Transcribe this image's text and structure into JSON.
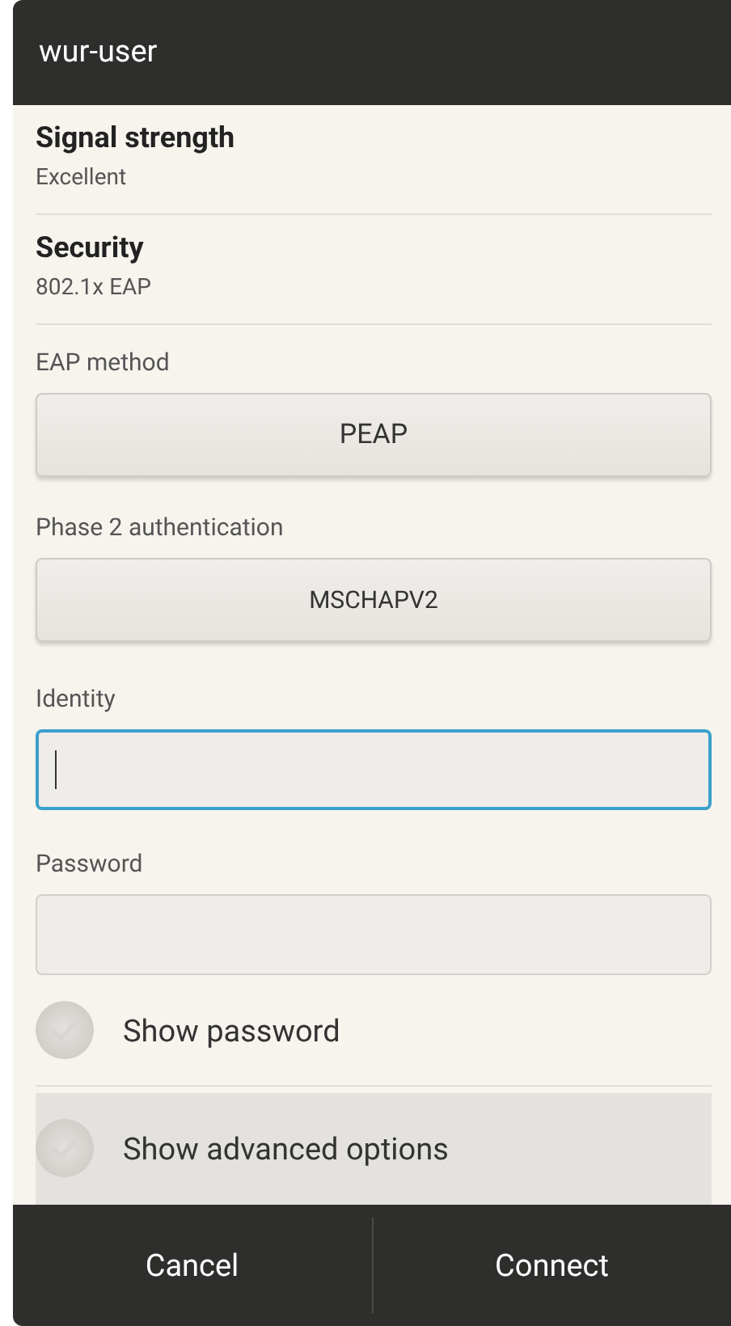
{
  "window": {
    "title": "wur-user"
  },
  "info": [
    {
      "label": "Signal strength",
      "value": "Excellent"
    },
    {
      "label": "Security",
      "value": "802.1x EAP"
    }
  ],
  "eap_method": {
    "label": "EAP method",
    "value": "PEAP"
  },
  "phase2": {
    "label": "Phase 2 authentication",
    "value": "MSCHAPV2"
  },
  "identity": {
    "label": "Identity",
    "focused": true
  },
  "password": {
    "label": "Password",
    "focused": false
  },
  "checkboxes": [
    {
      "label": "Show password",
      "checked": false
    },
    {
      "label": "Show advanced options",
      "checked": false
    }
  ],
  "buttons": [
    "Cancel",
    "Connect"
  ]
}
